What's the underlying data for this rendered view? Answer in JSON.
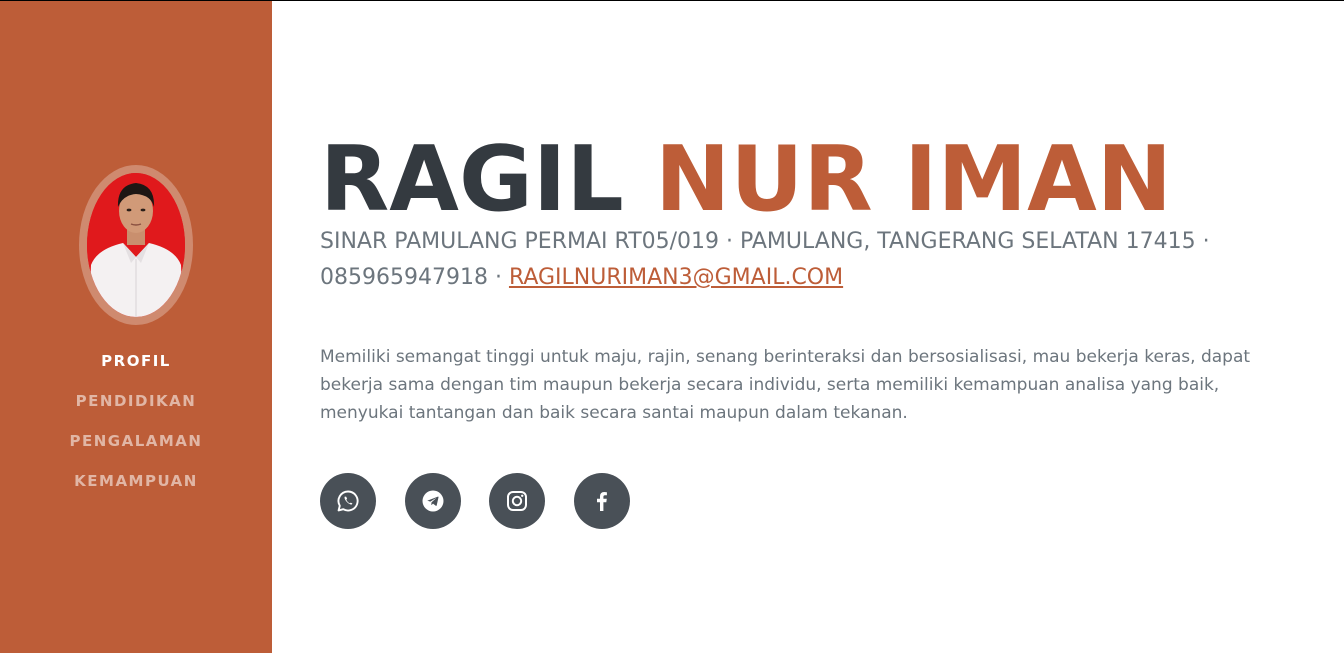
{
  "colors": {
    "accent": "#bd5d38",
    "heading": "#343a40",
    "muted": "#6c757d",
    "icon_bg": "#495057"
  },
  "sidebar": {
    "nav": [
      {
        "label": "PROFIL",
        "active": true
      },
      {
        "label": "PENDIDIKAN",
        "active": false
      },
      {
        "label": "PENGALAMAN",
        "active": false
      },
      {
        "label": "KEMAMPUAN",
        "active": false
      }
    ]
  },
  "profile": {
    "first_name": "RAGIL",
    "last_name": "NUR IMAN",
    "address": "SINAR PAMULANG PERMAI RT05/019 · PAMULANG, TANGERANG SELATAN 17415 ·",
    "phone": "085965947918 ·",
    "email": "RAGILNURIMAN3@GMAIL.COM",
    "summary": "Memiliki semangat tinggi untuk maju, rajin, senang berinteraksi dan bersosialisasi, mau bekerja keras, dapat bekerja sama dengan tim maupun bekerja secara individu, serta memiliki kemampuan analisa yang baik, menyukai tantangan dan baik secara santai maupun dalam tekanan."
  },
  "social": [
    {
      "icon": "whatsapp-icon"
    },
    {
      "icon": "telegram-icon"
    },
    {
      "icon": "instagram-icon"
    },
    {
      "icon": "facebook-icon"
    }
  ]
}
